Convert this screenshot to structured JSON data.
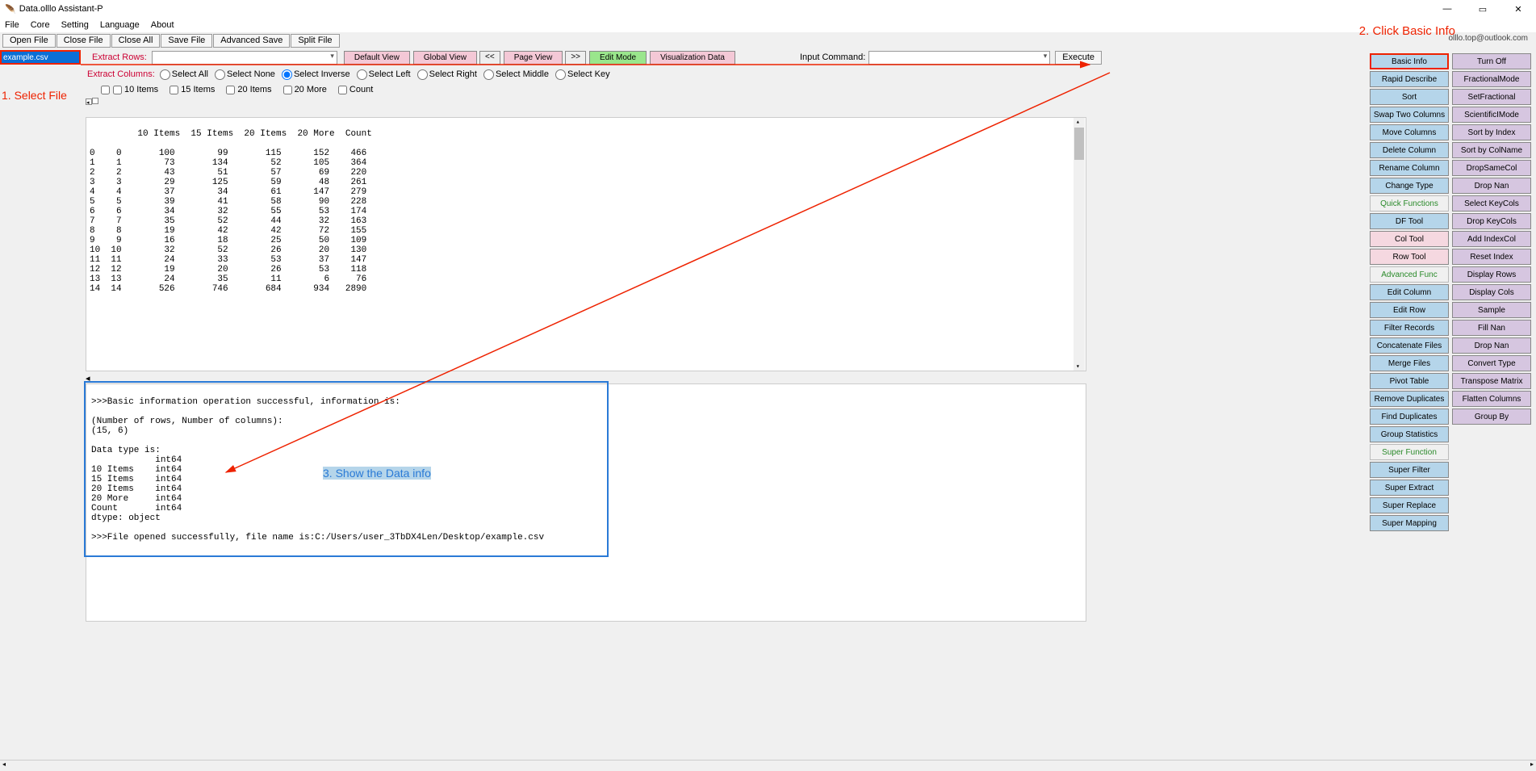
{
  "window": {
    "title": "Data.olllo Assistant-P"
  },
  "menu": {
    "file": "File",
    "core": "Core",
    "setting": "Setting",
    "language": "Language",
    "about": "About"
  },
  "toolbar": {
    "open": "Open File",
    "close": "Close File",
    "closeall": "Close All",
    "save": "Save File",
    "advsave": "Advanced Save",
    "split": "Split File",
    "email": "olllo.top@outlook.com"
  },
  "row2": {
    "file": "example.csv",
    "extract_rows": "Extract Rows:",
    "default_view": "Default View",
    "global_view": "Global View",
    "page_view": "Page View",
    "edit_mode": "Edit Mode",
    "viz": "Visualization Data",
    "prev": "<<",
    "next": ">>",
    "input_cmd": "Input Command:",
    "execute": "Execute"
  },
  "row3": {
    "extract_cols": "Extract Columns:",
    "selall": "Select All",
    "selnone": "Select None",
    "selinv": "Select Inverse",
    "selleft": "Select Left",
    "selright": "Select Right",
    "selmid": "Select Middle",
    "selkey": "Select Key"
  },
  "row4": {
    "c1": "10 Items",
    "c2": "15 Items",
    "c3": "20 Items",
    "c4": "20 More",
    "c5": "Count"
  },
  "data_header": "         10 Items  15 Items  20 Items  20 More  Count",
  "data_rows": [
    "0    0       100        99       115      152    466",
    "1    1        73       134        52      105    364",
    "2    2        43        51        57       69    220",
    "3    3        29       125        59       48    261",
    "4    4        37        34        61      147    279",
    "5    5        39        41        58       90    228",
    "6    6        34        32        55       53    174",
    "7    7        35        52        44       32    163",
    "8    8        19        42        42       72    155",
    "9    9        16        18        25       50    109",
    "10  10        32        52        26       20    130",
    "11  11        24        33        53       37    147",
    "12  12        19        20        26       53    118",
    "13  13        24        35        11        6     76",
    "14  14       526       746       684      934   2890"
  ],
  "output_lines": [
    ">>>Basic information operation successful, information is:",
    "",
    "(Number of rows, Number of columns):",
    "(15, 6)",
    "",
    "Data type is:",
    "            int64",
    "10 Items    int64",
    "15 Items    int64",
    "20 Items    int64",
    "20 More     int64",
    "Count       int64",
    "dtype: object",
    "",
    ">>>File opened successfully, file name is:C:/Users/user_3TbDX4Len/Desktop/example.csv"
  ],
  "right_col1": [
    {
      "label": "Basic Info",
      "cls": "blue highlight"
    },
    {
      "label": "Rapid Describe",
      "cls": "blue"
    },
    {
      "label": "Sort",
      "cls": "blue"
    },
    {
      "label": "Swap Two Columns",
      "cls": "blue"
    },
    {
      "label": "Move Columns",
      "cls": "blue"
    },
    {
      "label": "Delete Column",
      "cls": "blue"
    },
    {
      "label": "Rename Column",
      "cls": "blue"
    },
    {
      "label": "Change Type",
      "cls": "blue"
    },
    {
      "label": "Quick Functions",
      "cls": "greenhdr"
    },
    {
      "label": "DF Tool",
      "cls": "blue"
    },
    {
      "label": "Col Tool",
      "cls": "pink"
    },
    {
      "label": "Row Tool",
      "cls": "pink"
    },
    {
      "label": "Advanced Func",
      "cls": "greenhdr"
    },
    {
      "label": "Edit Column",
      "cls": "blue"
    },
    {
      "label": "Edit Row",
      "cls": "blue"
    },
    {
      "label": "Filter Records",
      "cls": "blue"
    },
    {
      "label": "Concatenate Files",
      "cls": "blue"
    },
    {
      "label": "Merge Files",
      "cls": "blue"
    },
    {
      "label": "Pivot Table",
      "cls": "blue"
    },
    {
      "label": "Remove Duplicates",
      "cls": "blue"
    },
    {
      "label": "Find Duplicates",
      "cls": "blue"
    },
    {
      "label": "Group Statistics",
      "cls": "blue"
    },
    {
      "label": "Super Function",
      "cls": "greenhdr"
    },
    {
      "label": "Super Filter",
      "cls": "blue"
    },
    {
      "label": "Super Extract",
      "cls": "blue"
    },
    {
      "label": "Super Replace",
      "cls": "blue"
    },
    {
      "label": "Super Mapping",
      "cls": "blue"
    }
  ],
  "right_col2": [
    {
      "label": "Turn Off",
      "cls": "purple"
    },
    {
      "label": "FractionalMode",
      "cls": "purple"
    },
    {
      "label": "SetFractional",
      "cls": "purple"
    },
    {
      "label": "ScientificIMode",
      "cls": "purple"
    },
    {
      "label": "Sort by Index",
      "cls": "purple"
    },
    {
      "label": "Sort by ColName",
      "cls": "purple"
    },
    {
      "label": "DropSameCol",
      "cls": "purple"
    },
    {
      "label": "Drop Nan",
      "cls": "purple"
    },
    {
      "label": "Select KeyCols",
      "cls": "purple"
    },
    {
      "label": "Drop KeyCols",
      "cls": "purple"
    },
    {
      "label": "Add IndexCol",
      "cls": "purple"
    },
    {
      "label": "Reset Index",
      "cls": "purple"
    },
    {
      "label": "Display Rows",
      "cls": "purple"
    },
    {
      "label": "Display Cols",
      "cls": "purple"
    },
    {
      "label": "Sample",
      "cls": "purple"
    },
    {
      "label": "Fill Nan",
      "cls": "purple"
    },
    {
      "label": "Drop Nan",
      "cls": "purple"
    },
    {
      "label": "Convert Type",
      "cls": "purple"
    },
    {
      "label": "Transpose Matrix",
      "cls": "purple"
    },
    {
      "label": "Flatten Columns",
      "cls": "purple"
    },
    {
      "label": "Group By",
      "cls": "purple"
    }
  ],
  "annotations": {
    "a1": "1. Select File",
    "a2": "2. Click Basic Info",
    "a3": "3. Show the Data info"
  }
}
